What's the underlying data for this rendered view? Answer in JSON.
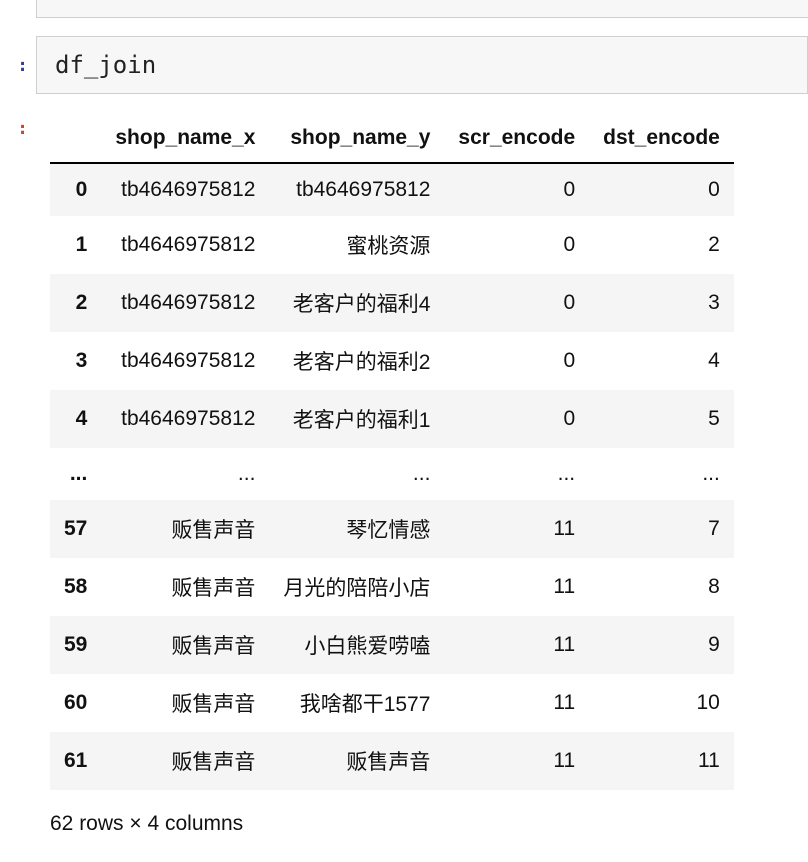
{
  "prompts": {
    "in_marker": ":",
    "out_marker": ":"
  },
  "input_cell": {
    "code": "df_join"
  },
  "table": {
    "columns": [
      "shop_name_x",
      "shop_name_y",
      "scr_encode",
      "dst_encode"
    ],
    "rows": [
      {
        "idx": "0",
        "c0": "tb4646975812",
        "c1": "tb4646975812",
        "c2": "0",
        "c3": "0"
      },
      {
        "idx": "1",
        "c0": "tb4646975812",
        "c1": "蜜桃资源",
        "c2": "0",
        "c3": "2"
      },
      {
        "idx": "2",
        "c0": "tb4646975812",
        "c1": "老客户的福利4",
        "c2": "0",
        "c3": "3"
      },
      {
        "idx": "3",
        "c0": "tb4646975812",
        "c1": "老客户的福利2",
        "c2": "0",
        "c3": "4"
      },
      {
        "idx": "4",
        "c0": "tb4646975812",
        "c1": "老客户的福利1",
        "c2": "0",
        "c3": "5"
      },
      {
        "idx": "...",
        "c0": "...",
        "c1": "...",
        "c2": "...",
        "c3": "..."
      },
      {
        "idx": "57",
        "c0": "贩售声音",
        "c1": "琴忆情感",
        "c2": "11",
        "c3": "7"
      },
      {
        "idx": "58",
        "c0": "贩售声音",
        "c1": "月光的陪陪小店",
        "c2": "11",
        "c3": "8"
      },
      {
        "idx": "59",
        "c0": "贩售声音",
        "c1": "小白熊爱唠嗑",
        "c2": "11",
        "c3": "9"
      },
      {
        "idx": "60",
        "c0": "贩售声音",
        "c1": "我啥都干1577",
        "c2": "11",
        "c3": "10"
      },
      {
        "idx": "61",
        "c0": "贩售声音",
        "c1": "贩售声音",
        "c2": "11",
        "c3": "11"
      }
    ]
  },
  "footer": {
    "shape_text": "62 rows × 4 columns"
  }
}
